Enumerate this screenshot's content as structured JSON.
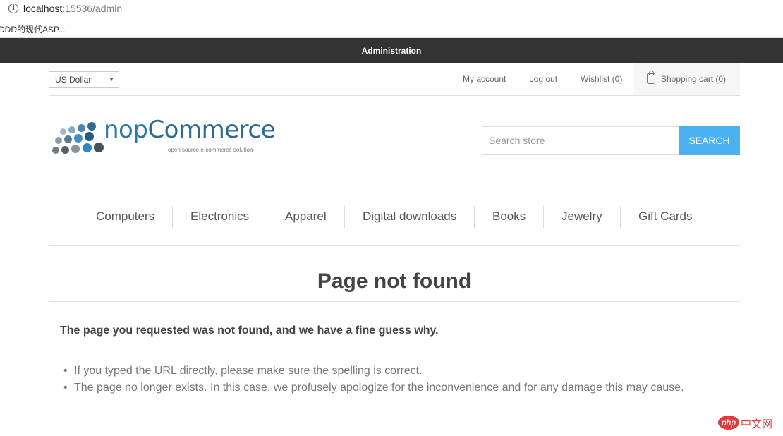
{
  "browser": {
    "url_host": "localhost",
    "url_rest": ":15536/admin",
    "bookmark": "DDD的现代ASP..."
  },
  "admin_bar": {
    "label": "Administration"
  },
  "header": {
    "currency": "US Dollar",
    "links": {
      "my_account": "My account",
      "log_out": "Log out",
      "wishlist": "Wishlist (0)",
      "shopping_cart": "Shopping cart (0)"
    },
    "logo": {
      "word_nop": "nop",
      "word_commerce": "Commerce",
      "tagline": "open source e-commerce solution"
    },
    "search": {
      "placeholder": "Search store",
      "button": "SEARCH"
    }
  },
  "menu": {
    "items": [
      "Computers",
      "Electronics",
      "Apparel",
      "Digital downloads",
      "Books",
      "Jewelry",
      "Gift Cards"
    ]
  },
  "content": {
    "title": "Page not found",
    "lead": "The page you requested was not found, and we have a fine guess why.",
    "bullets": [
      "If you typed the URL directly, please make sure the spelling is correct.",
      "The page no longer exists. In this case, we profusely apologize for the inconvenience and for any damage this may cause."
    ]
  },
  "watermark": {
    "php": "php",
    "cn": "中文网"
  },
  "colors": {
    "admin_bar": "#333333",
    "search_button": "#4ab2f1",
    "logo_blue": "#2b7aa7"
  }
}
